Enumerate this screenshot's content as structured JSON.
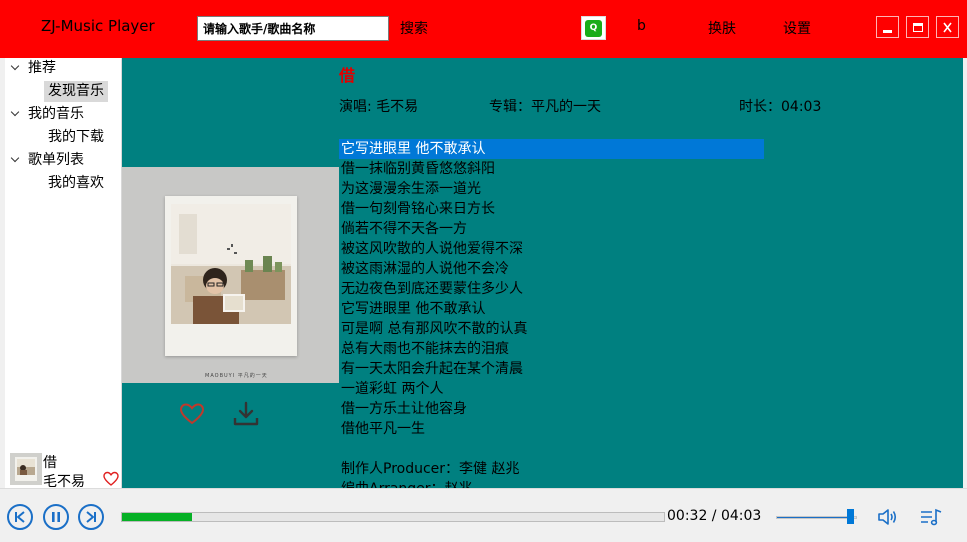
{
  "app": {
    "title": "ZJ-Music Player",
    "search_placeholder": "请输入歌手/歌曲名称",
    "search_button": "搜索",
    "user_label": "b",
    "skin_button": "换肤",
    "settings_button": "设置",
    "app_icon_text": "Q",
    "accent_color": "#ff0000"
  },
  "sidebar": {
    "groups": [
      {
        "label": "推荐",
        "children": [
          {
            "label": "发现音乐",
            "selected": true
          }
        ]
      },
      {
        "label": "我的音乐",
        "children": [
          {
            "label": "我的下载",
            "selected": false
          }
        ]
      },
      {
        "label": "歌单列表",
        "children": [
          {
            "label": "我的喜欢",
            "selected": false
          }
        ]
      }
    ]
  },
  "now_playing_mini": {
    "title": "借",
    "artist": "毛不易"
  },
  "song": {
    "title": "借",
    "artist_label": "演唱: 毛不易",
    "album_label": "专辑：平凡的一天",
    "duration_label": "时长：04:03",
    "album_caption": "MAOBUYI   平凡的一天"
  },
  "lyrics": {
    "active_index": 0,
    "lines": [
      "它写进眼里 他不敢承认",
      "借一抹临别黄昏悠悠斜阳",
      "为这漫漫余生添一道光",
      "借一句刻骨铭心来日方长",
      "倘若不得不天各一方",
      "被这风吹散的人说他爱得不深",
      "被这雨淋湿的人说他不会冷",
      "无边夜色到底还要蒙住多少人",
      "它写进眼里 他不敢承认",
      "可是啊 总有那风吹不散的认真",
      "总有大雨也不能抹去的泪痕",
      "有一天太阳会升起在某个清晨",
      "一道彩虹 两个人",
      "借一方乐土让他容身",
      "借他平凡一生",
      "",
      "制作人Producer：李健 赵兆",
      "编曲Arranger：赵兆"
    ]
  },
  "player": {
    "current_time": "00:32",
    "separator": " / ",
    "total_time": "04:03",
    "progress_fraction": 0.13,
    "volume_fraction": 0.92,
    "progress_color": "#06b025",
    "control_color": "#1a6fc7"
  },
  "icons": {
    "prev": "skip-previous-icon",
    "pause": "pause-icon",
    "next": "skip-next-icon",
    "heart": "heart-icon",
    "download": "download-icon",
    "volume": "volume-icon",
    "playlist": "playlist-icon"
  }
}
